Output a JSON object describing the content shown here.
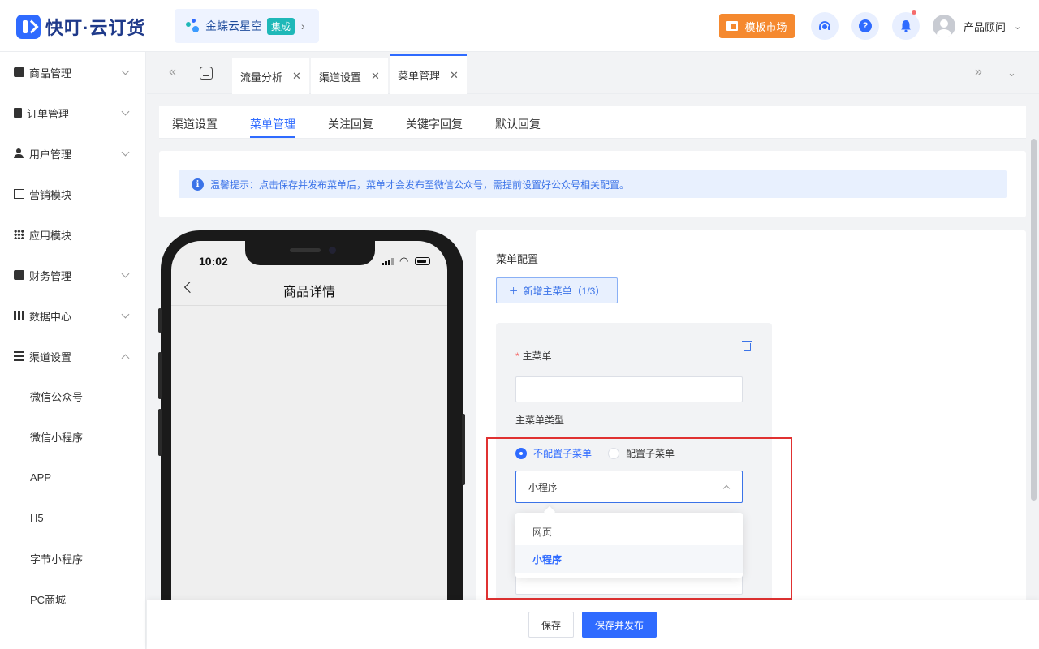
{
  "header": {
    "logo_text": "快叮·云订货",
    "product": {
      "name": "金蝶云星空",
      "badge": "集成"
    },
    "market_button": "模板市场",
    "user_name": "产品顾问"
  },
  "sidebar": {
    "items": [
      {
        "label": "商品管理",
        "icon": "bag-icon",
        "expandable": true
      },
      {
        "label": "订单管理",
        "icon": "clipboard-icon",
        "expandable": true
      },
      {
        "label": "用户管理",
        "icon": "user-icon",
        "expandable": true
      },
      {
        "label": "营销模块",
        "icon": "trend-icon",
        "expandable": false
      },
      {
        "label": "应用模块",
        "icon": "grid-icon",
        "expandable": false
      },
      {
        "label": "财务管理",
        "icon": "wallet-icon",
        "expandable": true
      },
      {
        "label": "数据中心",
        "icon": "bar-chart-icon",
        "expandable": true
      },
      {
        "label": "渠道设置",
        "icon": "list-icon",
        "expandable": true,
        "expanded": true
      }
    ],
    "sub_items": [
      "微信公众号",
      "微信小程序",
      "APP",
      "H5",
      "字节小程序",
      "PC商城"
    ]
  },
  "tabs": [
    {
      "label": "流量分析",
      "active": false
    },
    {
      "label": "渠道设置",
      "active": false
    },
    {
      "label": "菜单管理",
      "active": true
    }
  ],
  "subtabs": [
    {
      "label": "渠道设置",
      "active": false
    },
    {
      "label": "菜单管理",
      "active": true
    },
    {
      "label": "关注回复",
      "active": false
    },
    {
      "label": "关键字回复",
      "active": false
    },
    {
      "label": "默认回复",
      "active": false
    }
  ],
  "notice": "温馨提示：点击保存并发布菜单后，菜单才会发布至微信公众号，需提前设置好公众号相关配置。",
  "phone": {
    "time": "10:02",
    "page_title": "商品详情"
  },
  "config": {
    "title": "菜单配置",
    "add_button": "新增主菜单（1/3）",
    "main_menu_label": "主菜单",
    "main_menu_value": "",
    "type_label": "主菜单类型",
    "radio_options": [
      {
        "label": "不配置子菜单",
        "checked": true
      },
      {
        "label": "配置子菜单",
        "checked": false
      }
    ],
    "select_value": "小程序",
    "dropdown_options": [
      {
        "label": "网页",
        "selected": false
      },
      {
        "label": "小程序",
        "selected": true
      }
    ]
  },
  "footer": {
    "save": "保存",
    "publish": "保存并发布"
  },
  "colors": {
    "primary": "#2f6bff",
    "accent_orange": "#f5892f",
    "highlight_red": "#e03131",
    "badge_teal": "#1fb8b8"
  }
}
